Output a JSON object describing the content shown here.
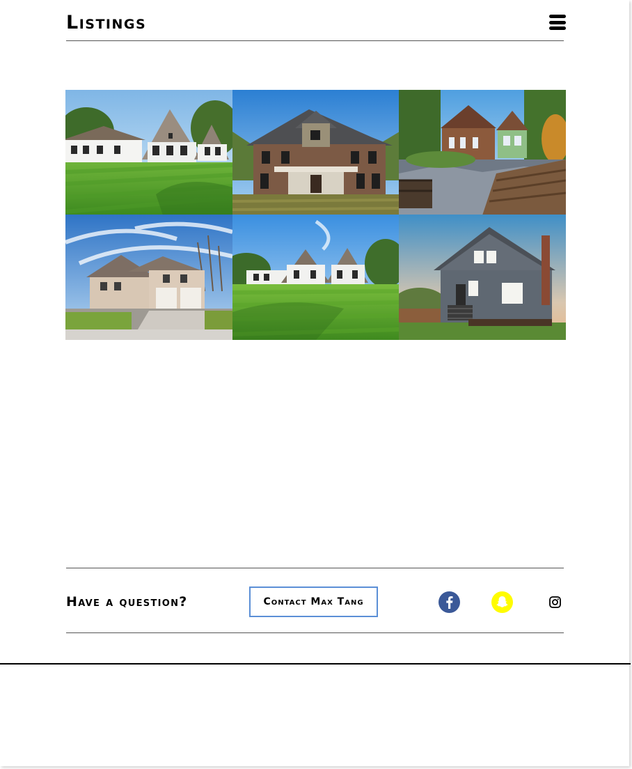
{
  "header": {
    "title": "Listings",
    "menu_icon": "hamburger-menu-icon"
  },
  "listings": [
    {
      "id": "listing-1",
      "image": "white-farmhouse-photo"
    },
    {
      "id": "listing-2",
      "image": "brick-two-story-house-photo"
    },
    {
      "id": "listing-3",
      "image": "cottage-garden-photo"
    },
    {
      "id": "listing-4",
      "image": "beige-house-garage-photo"
    },
    {
      "id": "listing-5",
      "image": "white-farmhouse-lawn-photo"
    },
    {
      "id": "listing-6",
      "image": "gray-bungalow-photo"
    }
  ],
  "footer": {
    "question": "Have a question?",
    "contact_label": "Contact Max Tang",
    "social": [
      "facebook-icon",
      "snapchat-icon",
      "instagram-icon"
    ]
  },
  "colors": {
    "contact_border": "#5b8fd6",
    "facebook": "#3b5998",
    "snapchat": "#fffc00",
    "lawn": "#5ea82e",
    "sky": "#3d8fd1"
  }
}
